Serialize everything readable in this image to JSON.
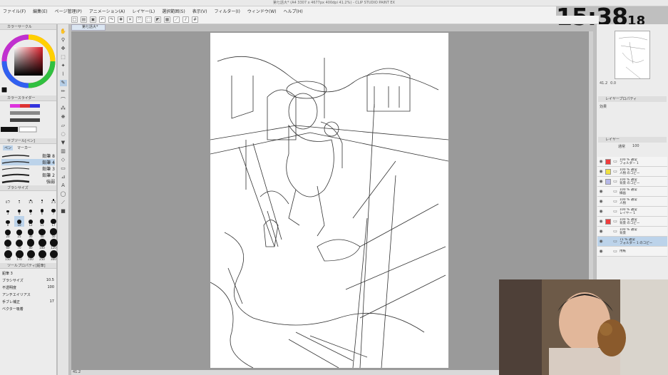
{
  "window": {
    "title": "第七話大* (A4 3307 x 4677px 400dpi 41.2%) - CLIP STUDIO PAINT EX",
    "doc_tab": "第七話大*"
  },
  "menu": [
    "ファイル(F)",
    "編集(E)",
    "ページ管理(P)",
    "アニメーション(A)",
    "レイヤー(L)",
    "選択範囲(S)",
    "表示(V)",
    "フィルター(I)",
    "ウィンドウ(W)",
    "ヘルプ(H)"
  ],
  "clock": {
    "main": "15:38",
    "seconds": "18"
  },
  "left_panel": {
    "color_wheel_tab": "カラーサークル",
    "slider_tab": "カラースライダー",
    "subtool_tab": "サブツール[ペン]",
    "pen_tab": "ペン",
    "marker_tab": "マーカー",
    "brushes": [
      "鉛筆 8",
      "鉛筆 4",
      "鉛筆 3",
      "鉛筆 2",
      "強弱"
    ],
    "brush_size_tab": "ブラシサイズ",
    "size_values": [
      "0.7",
      "1",
      "1.5",
      "2",
      "2.5",
      "3",
      "4",
      "5",
      "6",
      "7",
      "8",
      "10",
      "12",
      "15",
      "17",
      "20",
      "25",
      "30",
      "40",
      "50",
      "60",
      "70",
      "80",
      "100",
      "120",
      "150",
      "170",
      "200",
      "250",
      "300"
    ],
    "tool_property_tab": "ツールプロパティ[鉛筆]",
    "props": [
      {
        "label": "鉛筆 3",
        "value": ""
      },
      {
        "label": "ブラシサイズ",
        "value": "10.5"
      },
      {
        "label": "不透明度",
        "value": "100"
      },
      {
        "label": "アンチエイリアス",
        "value": ""
      },
      {
        "label": "手ブレ補正",
        "value": "17"
      },
      {
        "label": "ベクター吸着",
        "value": ""
      }
    ]
  },
  "status": {
    "zoom": "41.2"
  },
  "right_panel": {
    "navigator_zoom": "41.2",
    "navigator_angle": "0.0",
    "layer_property_tab": "レイヤープロパティ",
    "effect_label": "効果",
    "layer_tab": "レイヤー",
    "blend_mode": "通常",
    "opacity": "100",
    "layers": [
      {
        "name": "100 % 通常\nフォルダー 1",
        "swatch": "#f03c3c",
        "selected": false
      },
      {
        "name": "100 % 通常\n人物 のコピー",
        "swatch": "#f0e040",
        "selected": false
      },
      {
        "name": "100 % 通常\n背景 のコピー",
        "swatch": "#b6b8e8",
        "selected": false
      },
      {
        "name": "100 % 通常\n線画",
        "swatch": "",
        "selected": false
      },
      {
        "name": "100 % 通常\n人物",
        "swatch": "",
        "selected": false
      },
      {
        "name": "100 % 通常\nレイヤー 1",
        "swatch": "",
        "selected": false
      },
      {
        "name": "100 % 通常\n背景 のコピー",
        "swatch": "#f03c3c",
        "selected": false
      },
      {
        "name": "100 % 通常\n背景",
        "swatch": "",
        "selected": false
      },
      {
        "name": "71 % 通常\nフォルダー 1 のコピー",
        "swatch": "",
        "selected": true
      },
      {
        "name": "用紙",
        "swatch": "",
        "selected": false
      }
    ]
  },
  "colors": {
    "accent": "#bcd3ea",
    "canvas_bg": "#9a9a9a",
    "red_tag": "#f03c3c",
    "yellow_tag": "#f0e040"
  }
}
